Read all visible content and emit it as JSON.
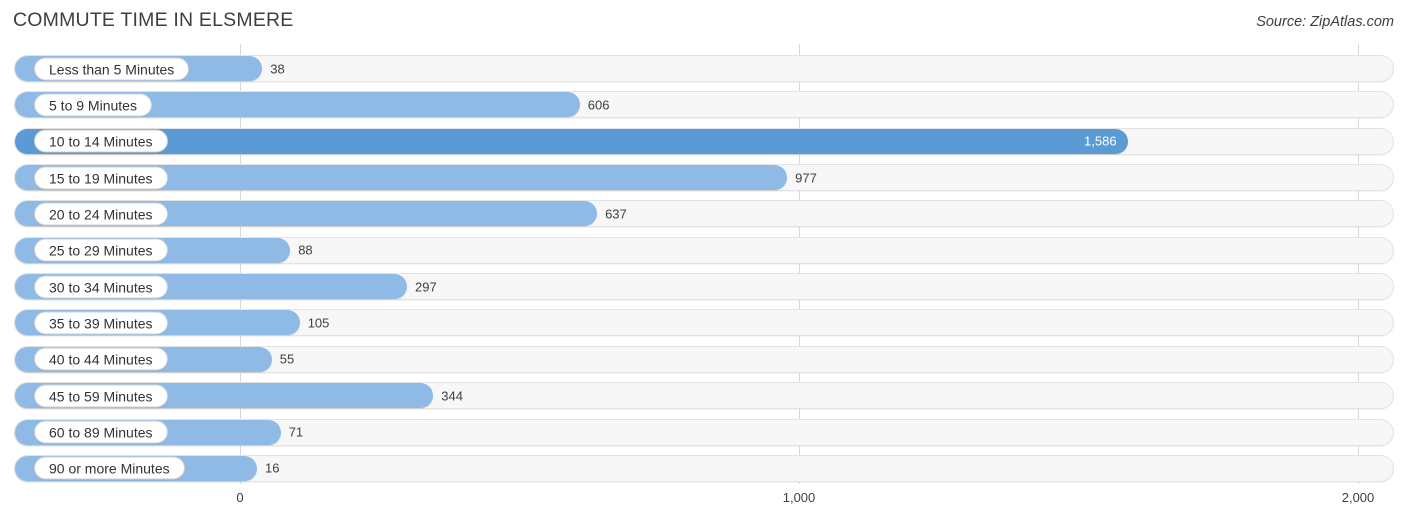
{
  "header": {
    "title": "COMMUTE TIME IN ELSMERE",
    "source": "Source: ZipAtlas.com"
  },
  "colors": {
    "bar": "#8fbae6",
    "bar_highlight": "#5b9bd5",
    "track": "#f7f7f7",
    "gridline": "#d9d9d9",
    "text": "#404040"
  },
  "chart_data": {
    "type": "bar",
    "orientation": "horizontal",
    "title": "COMMUTE TIME IN ELSMERE",
    "xlabel": "",
    "ylabel": "",
    "xlim": [
      0,
      2000
    ],
    "grid": true,
    "legend": "none",
    "ticks": [
      "0",
      "1,000",
      "2,000"
    ],
    "tick_values": [
      0,
      1000,
      2000
    ],
    "categories": [
      "Less than 5 Minutes",
      "5 to 9 Minutes",
      "10 to 14 Minutes",
      "15 to 19 Minutes",
      "20 to 24 Minutes",
      "25 to 29 Minutes",
      "30 to 34 Minutes",
      "35 to 39 Minutes",
      "40 to 44 Minutes",
      "45 to 59 Minutes",
      "60 to 89 Minutes",
      "90 or more Minutes"
    ],
    "values": [
      38,
      606,
      1586,
      977,
      637,
      88,
      297,
      105,
      55,
      344,
      71,
      16
    ],
    "value_labels": [
      "38",
      "606",
      "1,586",
      "977",
      "637",
      "88",
      "297",
      "105",
      "55",
      "344",
      "71",
      "16"
    ],
    "highlight_index": 2
  },
  "rows": [
    {
      "label": "Less than 5 Minutes",
      "value": 38,
      "value_label": "38",
      "highlight": false
    },
    {
      "label": "5 to 9 Minutes",
      "value": 606,
      "value_label": "606",
      "highlight": false
    },
    {
      "label": "10 to 14 Minutes",
      "value": 1586,
      "value_label": "1,586",
      "highlight": true
    },
    {
      "label": "15 to 19 Minutes",
      "value": 977,
      "value_label": "977",
      "highlight": false
    },
    {
      "label": "20 to 24 Minutes",
      "value": 637,
      "value_label": "637",
      "highlight": false
    },
    {
      "label": "25 to 29 Minutes",
      "value": 88,
      "value_label": "88",
      "highlight": false
    },
    {
      "label": "30 to 34 Minutes",
      "value": 297,
      "value_label": "297",
      "highlight": false
    },
    {
      "label": "35 to 39 Minutes",
      "value": 105,
      "value_label": "105",
      "highlight": false
    },
    {
      "label": "40 to 44 Minutes",
      "value": 55,
      "value_label": "55",
      "highlight": false
    },
    {
      "label": "45 to 59 Minutes",
      "value": 344,
      "value_label": "344",
      "highlight": false
    },
    {
      "label": "60 to 89 Minutes",
      "value": 71,
      "value_label": "71",
      "highlight": false
    },
    {
      "label": "90 or more Minutes",
      "value": 16,
      "value_label": "16",
      "highlight": false
    }
  ],
  "axis": {
    "ticks": [
      {
        "label": "0",
        "value": 0
      },
      {
        "label": "1,000",
        "value": 1000
      },
      {
        "label": "2,000",
        "value": 2000
      }
    ]
  }
}
